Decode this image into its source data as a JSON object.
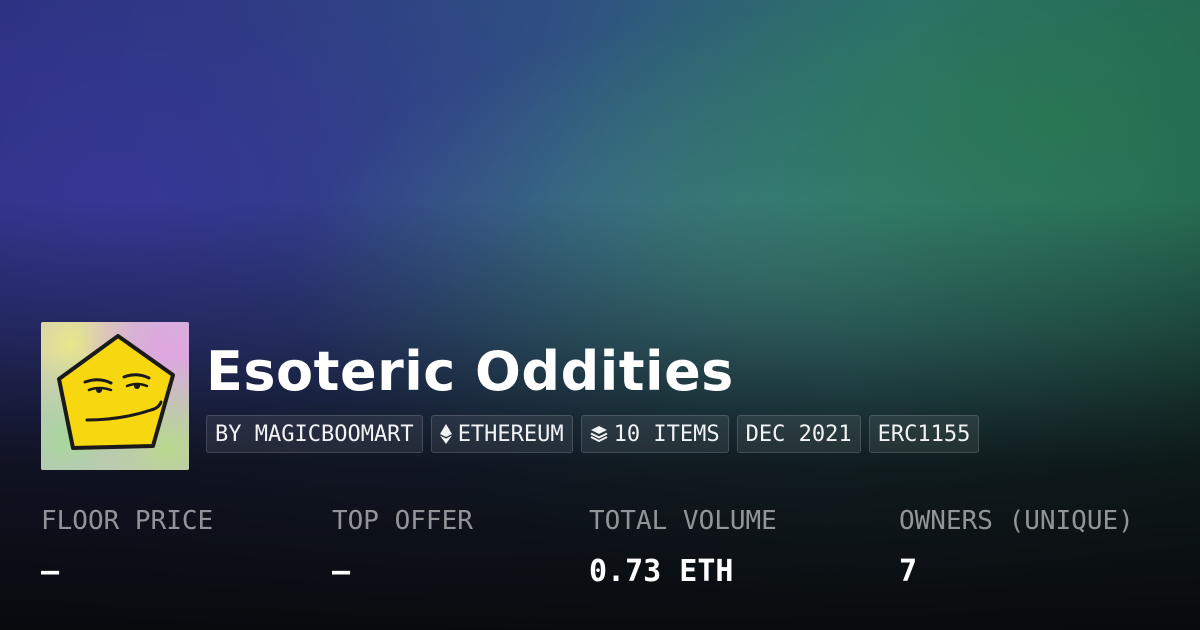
{
  "collection": {
    "title": "Esoteric Oddities",
    "avatar_icon": "smirking-pentagon-avatar"
  },
  "chips": [
    {
      "label": "BY MAGICBOOMART",
      "icon": ""
    },
    {
      "label": "ETHEREUM",
      "icon": "ethereum-icon"
    },
    {
      "label": "10 ITEMS",
      "icon": "layers-icon"
    },
    {
      "label": "DEC 2021",
      "icon": ""
    },
    {
      "label": "ERC1155",
      "icon": ""
    }
  ],
  "stats": [
    {
      "label": "FLOOR PRICE",
      "value": "—"
    },
    {
      "label": "TOP OFFER",
      "value": "—"
    },
    {
      "label": "TOTAL VOLUME",
      "value": "0.73 ETH"
    },
    {
      "label": "OWNERS (UNIQUE)",
      "value": "7"
    }
  ],
  "colors": {
    "title": "#ffffff",
    "label": "#9a9ca0",
    "avatar_face": "#f7d70f"
  }
}
